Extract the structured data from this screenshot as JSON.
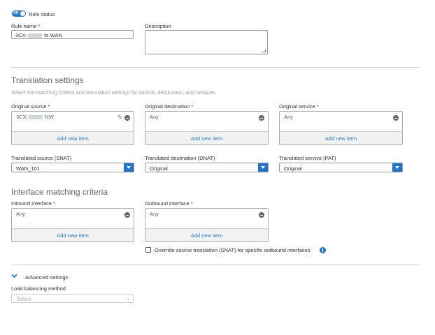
{
  "rule_status": {
    "toggle_text": "ON",
    "label": "Rule status"
  },
  "rule_name": {
    "label": "Rule name *",
    "value_prefix": "3CX-",
    "value_suffix": " to WAN"
  },
  "description": {
    "label": "Description",
    "value": ""
  },
  "translation": {
    "heading": "Translation settings",
    "subtitle": "Select the matching criteria and translation settings for source, destination, and services",
    "original_source": {
      "label": "Original source *",
      "item_prefix": "3CX-",
      "item_suffix": " NW",
      "add": "Add new item"
    },
    "original_destination": {
      "label": "Original destination *",
      "item": "Any",
      "add": "Add new item"
    },
    "original_service": {
      "label": "Original service *",
      "item": "Any",
      "add": "Add new item"
    },
    "translated_source": {
      "label": "Translated source (SNAT)",
      "value": "WAN_101"
    },
    "translated_destination": {
      "label": "Translated destination (DNAT)",
      "value": "Original"
    },
    "translated_service": {
      "label": "Translated service (PAT)",
      "value": "Original"
    }
  },
  "interface": {
    "heading": "Interface matching criteria",
    "inbound": {
      "label": "Inbound interface *",
      "item": "Any",
      "add": "Add new item"
    },
    "outbound": {
      "label": "Outbound interface *",
      "item": "Any",
      "add": "Add new item"
    },
    "override_label": "Override source translation (SNAT) for specific outbound interfaces",
    "override_checked": false
  },
  "advanced": {
    "label": "Advanced settings",
    "load_balancing_label": "Load balancing method",
    "load_balancing_placeholder": "Select"
  },
  "colors": {
    "accent": "#1f75cb",
    "link": "#1f75cb",
    "divider": "#d0d0d0"
  },
  "icons": {
    "remove": "minus-circle-icon",
    "edit": "pencil-icon",
    "info": "info-icon",
    "expand": "chevron-down-icon",
    "dropdown": "caret-down-icon"
  }
}
